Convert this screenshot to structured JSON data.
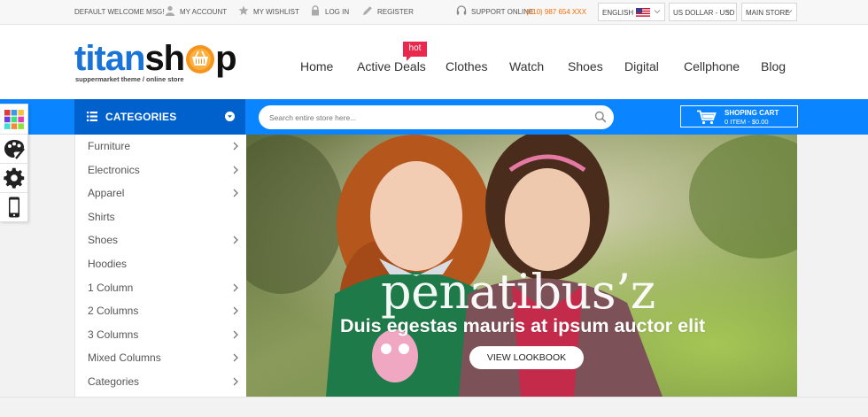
{
  "topbar": {
    "welcome": "DEFAULT WELCOME MSG!",
    "account": "MY ACCOUNT",
    "wishlist": "MY WISHLIST",
    "login": "LOG IN",
    "register": "REGISTER",
    "support_label": "SUPPORT ONLINE",
    "support_phone": "(010) 987 654 XXX",
    "language": "ENGLISH",
    "currency": "US DOLLAR - USD",
    "store": "MAIN STORE"
  },
  "logo": {
    "part1": "titan",
    "part2": "sh",
    "part3": "p",
    "tagline": "suppermarket theme / online store"
  },
  "nav": {
    "items": [
      "Home",
      "Active Deals",
      "Clothes",
      "Watch",
      "Shoes",
      "Digital",
      "Cellphone",
      "Blog"
    ],
    "hot_badge": "hot"
  },
  "categories": {
    "title": "CATEGORIES",
    "items": [
      {
        "label": "Furniture",
        "has_sub": true
      },
      {
        "label": "Electronics",
        "has_sub": true
      },
      {
        "label": "Apparel",
        "has_sub": true
      },
      {
        "label": "Shirts",
        "has_sub": false
      },
      {
        "label": "Shoes",
        "has_sub": true
      },
      {
        "label": "Hoodies",
        "has_sub": false
      },
      {
        "label": "1 Column",
        "has_sub": true
      },
      {
        "label": "2 Columns",
        "has_sub": true
      },
      {
        "label": "3 Columns",
        "has_sub": true
      },
      {
        "label": "Mixed Columns",
        "has_sub": true
      },
      {
        "label": "Categories",
        "has_sub": true
      }
    ]
  },
  "search": {
    "placeholder": "Search entire store here..."
  },
  "cart": {
    "title": "SHOPING CART",
    "summary": "0 ITEM - $0.00"
  },
  "banner": {
    "title": "penatibus’z",
    "subtitle": "Duis egestas mauris at ipsum auctor elit",
    "button": "VIEW LOOKBOOK"
  },
  "colors": {
    "accent_blue": "#0a84ff",
    "category_blue": "#0060cc",
    "logo_blue": "#1a73d9",
    "logo_orange": "#f7941d",
    "hot_red": "#e8284d",
    "phone_orange": "#ff6a00"
  },
  "icons": [
    "user-icon",
    "star-icon",
    "lock-icon",
    "pencil-icon",
    "headset-icon",
    "us-flag-icon",
    "chevron-down-icon",
    "list-icon",
    "search-icon",
    "cart-icon",
    "color-palette-icon",
    "paint-icon",
    "gear-icon",
    "mobile-icon",
    "chevron-right-icon"
  ]
}
